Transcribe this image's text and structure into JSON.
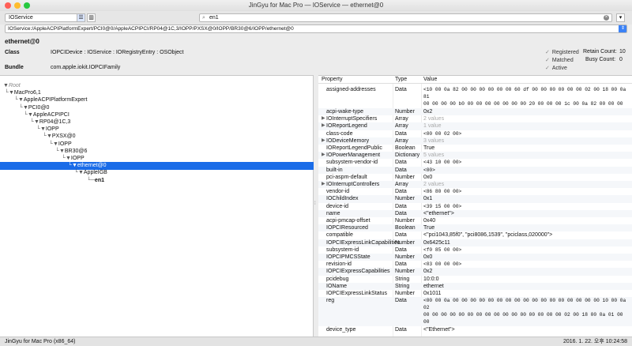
{
  "window": {
    "title": "JinGyu for Mac Pro — IOService — ethernet@0",
    "traffic_colors": [
      "#ff5f57",
      "#febc2e",
      "#28c840"
    ]
  },
  "toolbar": {
    "plane_select": "IOService",
    "search_value": "en1",
    "search_icon": "magnifier-icon"
  },
  "path": "IOService:/AppleACPIPlatformExpert/PCI0@0/AppleACPIPCI/RP04@1C,3/IOPP/PXSX@0/IOPP/BR30@6/IOPP/ethernet@0",
  "info": {
    "object_name": "ethernet@0",
    "class_label": "Class",
    "class_value": "IOPCIDevice : IOService : IORegistryEntry : OSObject",
    "bundle_label": "Bundle",
    "bundle_value": "com.apple.iokit.IOPCIFamily",
    "registered": "Registered",
    "matched": "Matched",
    "active": "Active",
    "retain_label": "Retain Count:",
    "retain_value": "10",
    "busy_label": "Busy Count:",
    "busy_value": "0"
  },
  "tree": [
    {
      "label": "Root",
      "italic": true
    },
    {
      "label": "MacPro6,1"
    },
    {
      "label": "AppleACPIPlatformExpert"
    },
    {
      "label": "PCI0@0"
    },
    {
      "label": "AppleACPIPCI"
    },
    {
      "label": "RP04@1C,3"
    },
    {
      "label": "IOPP"
    },
    {
      "label": "PXSX@0"
    },
    {
      "label": "IOPP"
    },
    {
      "label": "BR30@6"
    },
    {
      "label": "IOPP"
    },
    {
      "label": "ethernet@0",
      "selected": true
    },
    {
      "label": "AppleIGB"
    },
    {
      "label": "en1",
      "bold": true
    }
  ],
  "props_header": {
    "property": "Property",
    "type": "Type",
    "value": "Value"
  },
  "props": [
    {
      "name": "assigned-addresses",
      "type": "Data",
      "value": "<10 00 0a 82 00 00 00 00 00 00 60 df 00 00 00 00 00 00 02 00 18 00 0a 81\n00 00 00 00 b0 00 00 00 00 00 00 00 20 00 00 00 1c 00 0a 82 00 00 00 00\n00 00 62 df 00 00 00 00 00 40 00 00>",
      "mono": true,
      "h": 28
    },
    {
      "name": "acpi-wake-type",
      "type": "Number",
      "value": "0x2"
    },
    {
      "name": "IOInterruptSpecifiers",
      "type": "Array",
      "value": "2 values",
      "gray": true,
      "expand": true
    },
    {
      "name": "IOReportLegend",
      "type": "Array",
      "value": "1 value",
      "gray": true,
      "expand": true
    },
    {
      "name": "class-code",
      "type": "Data",
      "value": "<00 00 02 00>",
      "mono": true
    },
    {
      "name": "IODeviceMemory",
      "type": "Array",
      "value": "3 values",
      "gray": true,
      "expand": true
    },
    {
      "name": "IOReportLegendPublic",
      "type": "Boolean",
      "value": "True"
    },
    {
      "name": "IOPowerManagement",
      "type": "Dictionary",
      "value": "5 values",
      "gray": true,
      "expand": true
    },
    {
      "name": "subsystem-vendor-id",
      "type": "Data",
      "value": "<43 10 00 00>",
      "mono": true
    },
    {
      "name": "built-in",
      "type": "Data",
      "value": "<00>",
      "mono": true
    },
    {
      "name": "pci-aspm-default",
      "type": "Number",
      "value": "0x0"
    },
    {
      "name": "IOInterruptControllers",
      "type": "Array",
      "value": "2 values",
      "gray": true,
      "expand": true
    },
    {
      "name": "vendor-id",
      "type": "Data",
      "value": "<86 80 00 00>",
      "mono": true
    },
    {
      "name": "IOChildIndex",
      "type": "Number",
      "value": "0x1"
    },
    {
      "name": "device-id",
      "type": "Data",
      "value": "<39 15 00 00>",
      "mono": true
    },
    {
      "name": "name",
      "type": "Data",
      "value": "<\"ethernet\">"
    },
    {
      "name": "acpi-pmcap-offset",
      "type": "Number",
      "value": "0x40"
    },
    {
      "name": "IOPCIResourced",
      "type": "Boolean",
      "value": "True"
    },
    {
      "name": "compatible",
      "type": "Data",
      "value": "<\"pci1043,85f0\", \"pci8086,1539\", \"pciclass,020000\">"
    },
    {
      "name": "IOPCIExpressLinkCapabilities",
      "type": "Number",
      "value": "0x6425c11"
    },
    {
      "name": "subsystem-id",
      "type": "Data",
      "value": "<f0 85 00 00>",
      "mono": true
    },
    {
      "name": "IOPCIPMCSState",
      "type": "Number",
      "value": "0x0"
    },
    {
      "name": "revision-id",
      "type": "Data",
      "value": "<03 00 00 00>",
      "mono": true
    },
    {
      "name": "IOPCIExpressCapabilities",
      "type": "Number",
      "value": "0x2"
    },
    {
      "name": "pcidebug",
      "type": "String",
      "value": "10:0:0"
    },
    {
      "name": "IOName",
      "type": "String",
      "value": "ethernet"
    },
    {
      "name": "IOPCIExpressLinkStatus",
      "type": "Number",
      "value": "0x1011"
    },
    {
      "name": "reg",
      "type": "Data",
      "value": "<00 00 0a 00 00 00 00 00 00 00 00 00 00 00 00 00 00 00 00 00 10 00 0a 02\n00 00 00 00 00 00 00 00 00 00 00 00 00 00 00 00 02 00 18 00 0a 01 00 00\n00 00 00 00 00 00 00 00 00 20 00 00 1c 00 0a 02 00 00 00 00 00 00 00 00\n00 00 00 00 00 40 00 00>",
      "mono": true,
      "h": 37
    },
    {
      "name": "device_type",
      "type": "Data",
      "value": "<\"Ethernet\">"
    }
  ],
  "status": {
    "left": "JinGyu for Mac Pro (x86_64)",
    "right": "2016. 1. 22. 오후 10:24:58"
  }
}
